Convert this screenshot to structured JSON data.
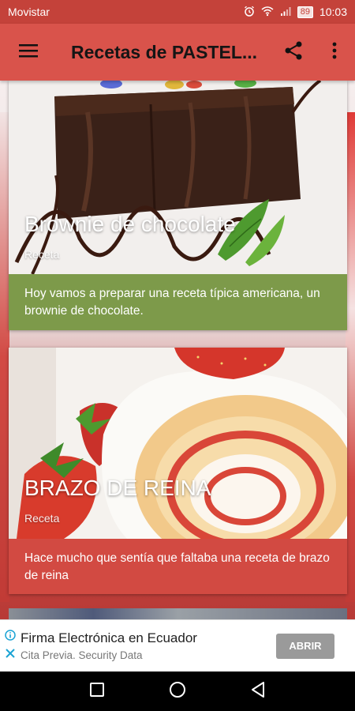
{
  "status_bar": {
    "carrier": "Movistar",
    "battery": "89",
    "time": "10:03",
    "icons": [
      "alarm-icon",
      "wifi-icon",
      "signal-icon",
      "battery-icon"
    ]
  },
  "app_bar": {
    "title": "Recetas de PASTEL...",
    "icons": [
      "menu-icon",
      "share-icon",
      "more-vert-icon"
    ]
  },
  "cards": [
    {
      "title": "Brownie de chocolate",
      "subtitle": "Receta",
      "description": "Hoy vamos a preparar una receta típica americana, un brownie de chocolate.",
      "accent": "#7d9a4a"
    },
    {
      "title": "BRAZO DE REINA",
      "subtitle": "Receta",
      "description": "Hace mucho que sentía que faltaba una receta de brazo de reina",
      "accent": "#d24a42"
    }
  ],
  "ad": {
    "title": "Firma Electrónica en Ecuador",
    "subtitle": "Cita Previa. Security Data",
    "button": "ABRIR",
    "icons": [
      "info-icon",
      "close-icon"
    ]
  },
  "nav_bar": {
    "icons": [
      "recents-icon",
      "home-icon",
      "back-icon"
    ]
  },
  "colors": {
    "primary": "#d9534b",
    "status_bar": "#c4423a",
    "card1_accent": "#7d9a4a",
    "card2_accent": "#d24a42"
  }
}
